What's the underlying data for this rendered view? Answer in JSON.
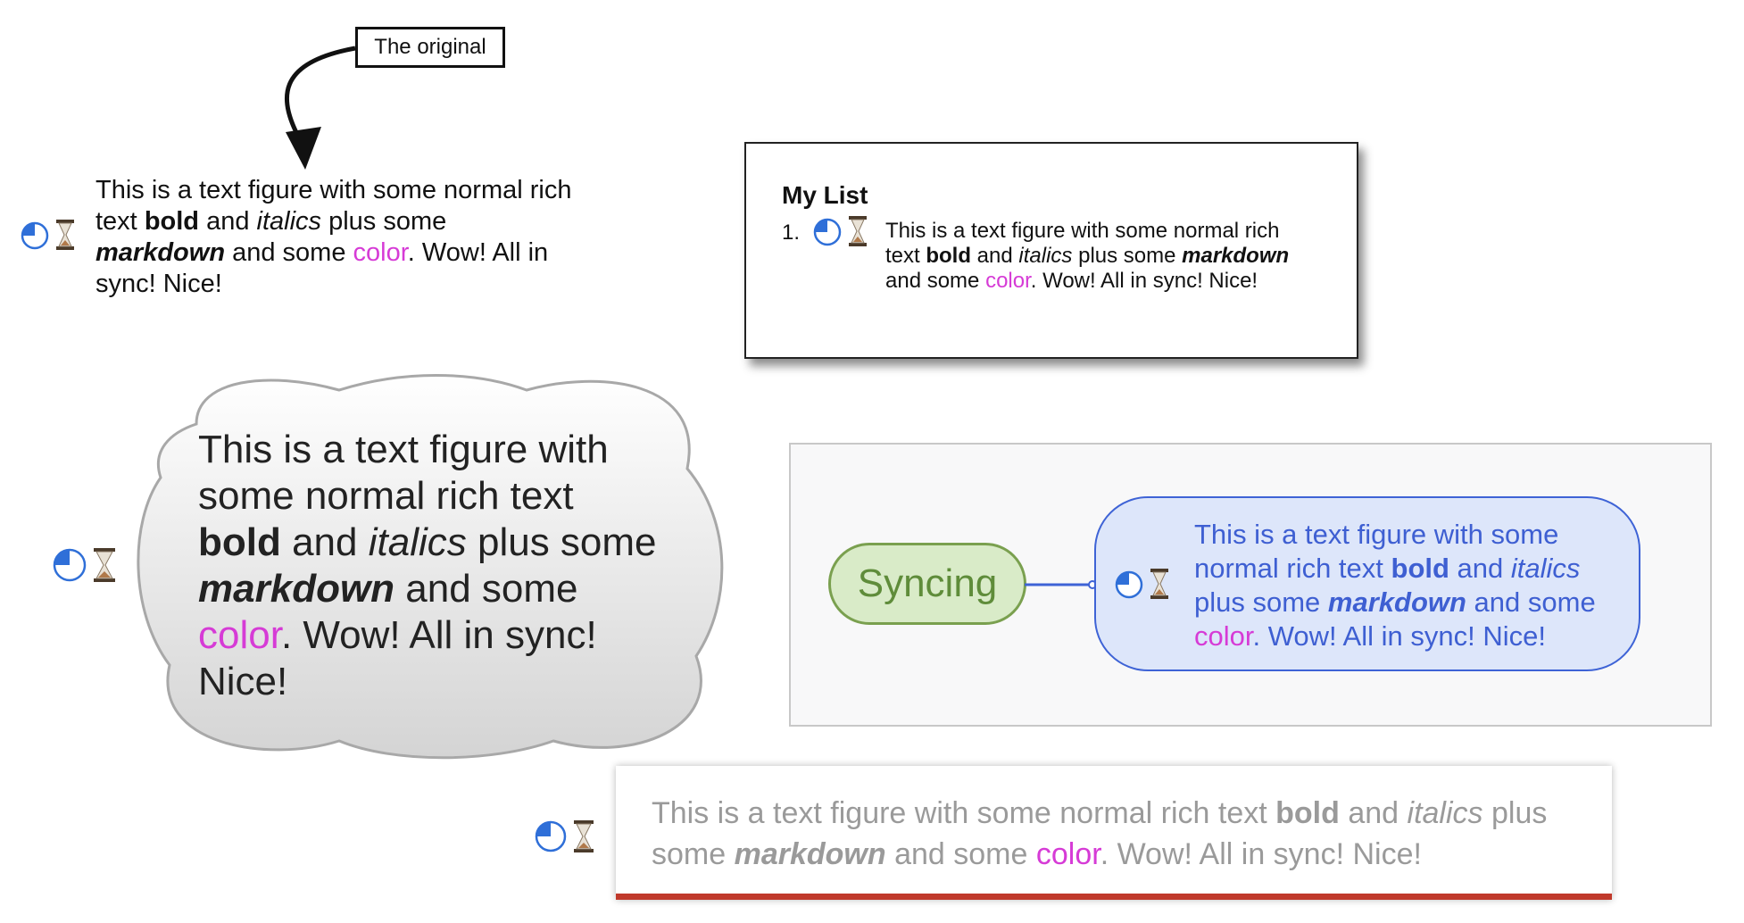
{
  "callout": {
    "label": "The original"
  },
  "figure_text": {
    "part1": "This is a text figure with some normal rich text ",
    "bold": "bold",
    "part2": " and ",
    "italic": "italics",
    "part3": " plus some ",
    "markdown": "markdown",
    "part4": " and some ",
    "color_word": "color",
    "part5": ". Wow! All in sync! Nice!"
  },
  "list": {
    "title": "My List",
    "item_number": "1."
  },
  "mindmap": {
    "parent_label": "Syncing"
  },
  "icons": [
    "pie-quarter-icon",
    "hourglass-icon"
  ],
  "colors": {
    "accent_pink": "#d63bd6",
    "topic_blue": "#3e5fd2",
    "syncing_green": "#5f8c3a",
    "bottom_rule_red": "#c0392b"
  }
}
